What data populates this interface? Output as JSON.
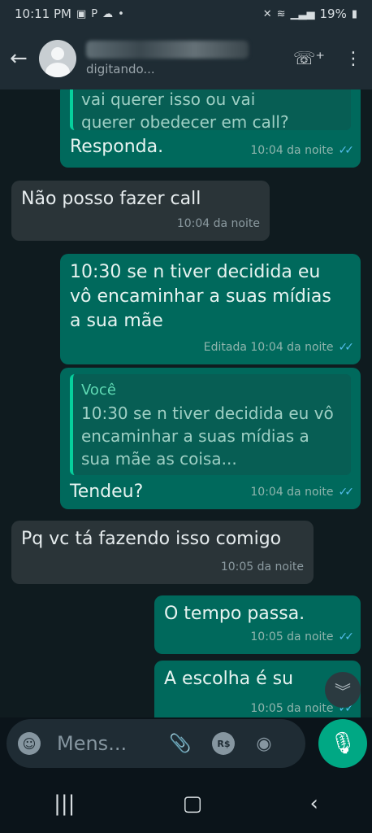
{
  "status_bar": {
    "time": "10:11 PM",
    "left_icons": [
      "image-icon",
      "p-icon",
      "cloud-icon",
      "dot-icon"
    ],
    "battery": "19%"
  },
  "header": {
    "typing_status": "digitando...",
    "icons": [
      "add-call-icon",
      "more-options-icon"
    ]
  },
  "messages": [
    {
      "id": "m1",
      "direction": "out",
      "quote": "vai querer isso ou vai\nquerer obedecer em call?",
      "text": "Responda.",
      "time": "10:04 da noite",
      "read": true
    },
    {
      "id": "m2",
      "direction": "in",
      "text": "Não posso fazer call",
      "time": "10:04 da noite"
    },
    {
      "id": "m3",
      "direction": "out",
      "text": "10:30 se n tiver decidida eu vô encaminhar a suas mídias a sua mãe",
      "time": "Editada 10:04 da noite",
      "read": true
    },
    {
      "id": "m4",
      "direction": "out",
      "quote_sender": "Você",
      "quote": "10:30 se n tiver decidida eu vô encaminhar a suas mídias a sua mãe as coisa...",
      "text": "Tendeu?",
      "time": "10:04 da noite",
      "read": true
    },
    {
      "id": "m5",
      "direction": "in",
      "text": "Pq vc tá fazendo isso comigo",
      "time": "10:05 da noite"
    },
    {
      "id": "m6",
      "direction": "out",
      "text": "O tempo passa.",
      "time": "10:05 da noite",
      "read": true
    },
    {
      "id": "m7",
      "direction": "out",
      "text": "A escolha é su",
      "time": "10:05 da noite",
      "read": true
    }
  ],
  "input": {
    "placeholder": "Mens...",
    "icons": [
      "emoji-icon",
      "attach-icon",
      "rs-icon",
      "camera-icon",
      "mic-icon"
    ],
    "rs_label": "R$"
  },
  "colors": {
    "outgoing_bubble": "#00695c",
    "incoming_bubble": "#2a3438",
    "accent": "#00a884",
    "read_ticks": "#53bdeb"
  }
}
